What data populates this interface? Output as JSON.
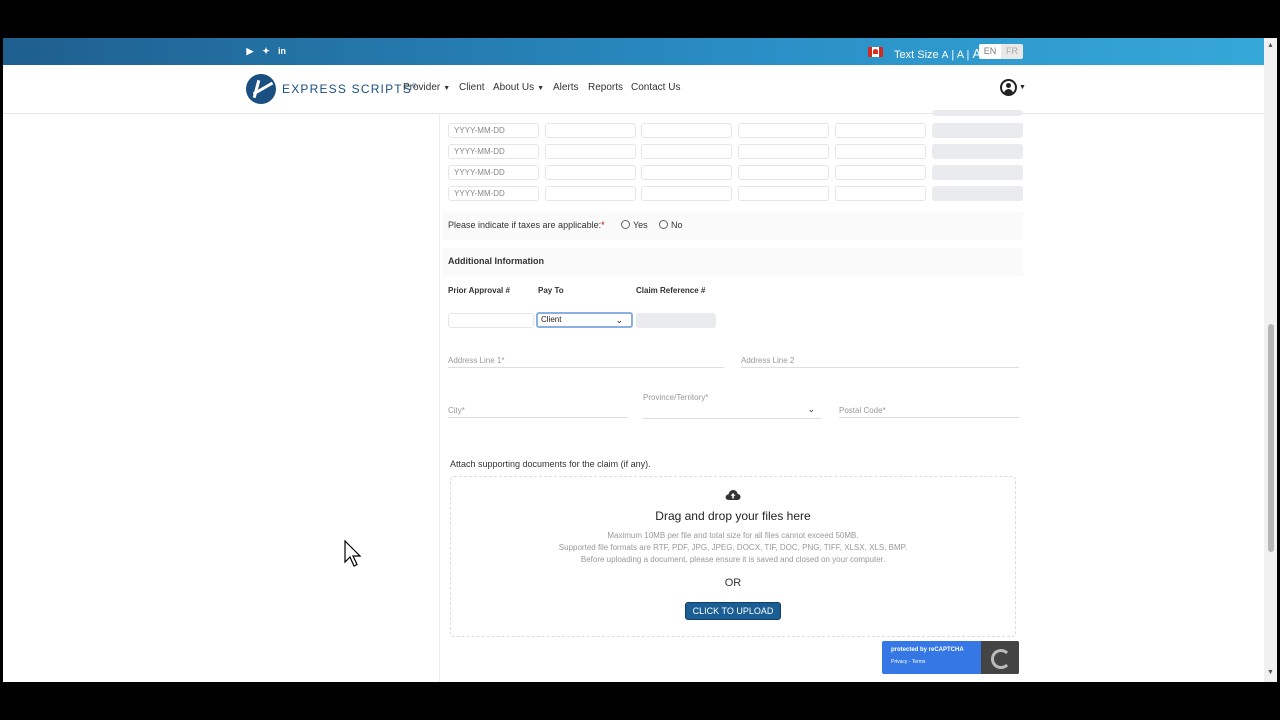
{
  "header": {
    "social": [
      "youtube-icon",
      "twitter-icon",
      "linkedin-icon"
    ],
    "text_size_label": "Text Size",
    "text_size_options": [
      "A",
      "A",
      "A"
    ],
    "lang": {
      "en": "EN",
      "fr": "FR"
    }
  },
  "nav": {
    "logo": "EXPRESS SCRIPTS",
    "logo_mark": "®",
    "items": [
      {
        "label": "Provider",
        "dropdown": true
      },
      {
        "label": "Client",
        "dropdown": false
      },
      {
        "label": "About Us",
        "dropdown": true
      },
      {
        "label": "Alerts",
        "dropdown": false
      },
      {
        "label": "Reports",
        "dropdown": false
      },
      {
        "label": "Contact Us",
        "dropdown": false
      }
    ]
  },
  "table": {
    "date_placeholder": "YYYY-MM-DD"
  },
  "taxes": {
    "question": "Please indicate if taxes are applicable:",
    "required": "*",
    "yes": "Yes",
    "no": "No"
  },
  "additional": {
    "title": "Additional Information",
    "prior_approval": "Prior Approval #",
    "pay_to": "Pay To",
    "claim_ref": "Claim Reference #",
    "pay_to_value": "Client",
    "address1": "Address Line 1",
    "address2": "Address Line 2",
    "city": "City",
    "province": "Province/Territory",
    "postal": "Postal Code",
    "required": "*"
  },
  "attach": {
    "label": "Attach supporting documents for the claim (if any).",
    "drag": "Drag and drop your files here",
    "line1": "Maximum 10MB per file and total size for all files cannot exceed 50MB.",
    "line2": "Supported file formats are RTF, PDF, JPG, JPEG, DOCX, TIF, DOC, PNG, TIFF, XLSX, XLS, BMP.",
    "line3": "Before uploading a document, please ensure it is saved and closed on your computer.",
    "or": "OR",
    "button": "CLICK TO UPLOAD"
  },
  "recaptcha": {
    "title": "protected by reCAPTCHA",
    "links": "Privacy - Terms"
  }
}
